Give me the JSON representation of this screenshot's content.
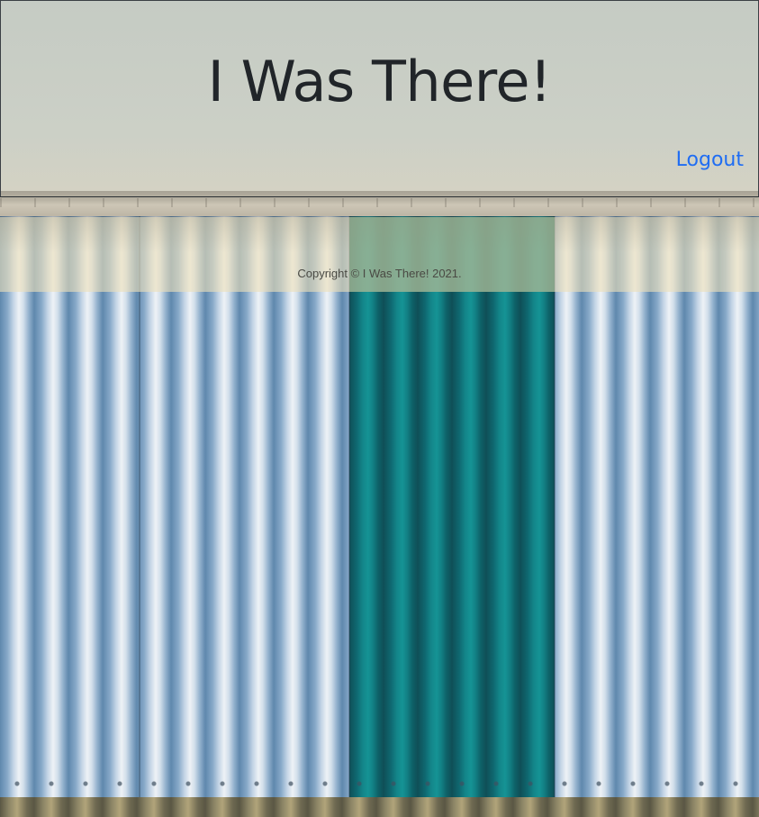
{
  "header": {
    "title": "I Was There!",
    "logout_label": "Logout"
  },
  "footer": {
    "copyright": "Copyright © I Was There! 2021."
  },
  "colors": {
    "link": "#1f6df3",
    "title_text": "#212529",
    "wall_blue": "#86a8c8",
    "wall_teal": "#0f6870"
  }
}
